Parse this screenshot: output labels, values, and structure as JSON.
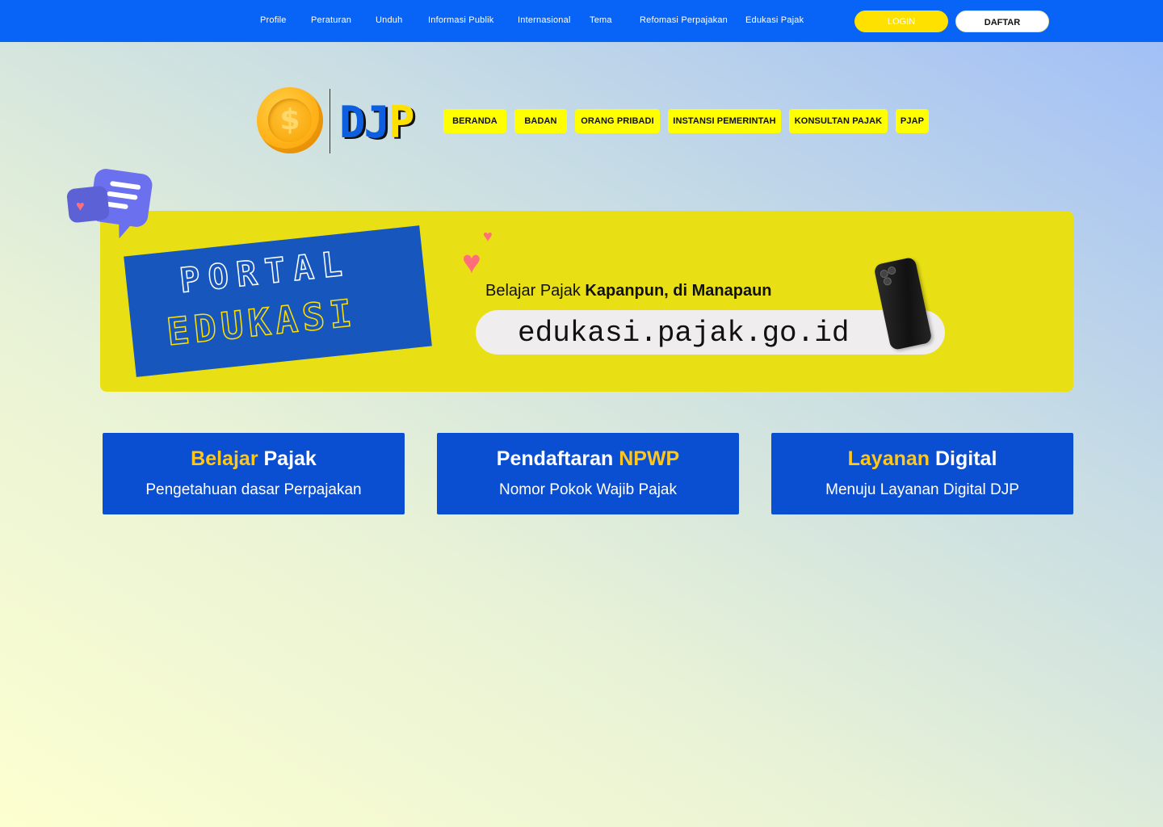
{
  "topnav": {
    "items": [
      "Profile",
      "Peraturan",
      "Unduh",
      "Informasi Publik",
      "Internasional",
      "Tema",
      "Refomasi Perpajakan",
      "Edukasi Pajak"
    ],
    "login_label": "LOGIN",
    "daftar_label": "DAFTAR"
  },
  "logo": {
    "text_dj": "DJ",
    "text_p": "P",
    "coin_symbol": "$"
  },
  "subnav": {
    "items": [
      "BERANDA",
      "BADAN",
      "ORANG PRIBADI",
      "INSTANSI PEMERINTAH",
      "KONSULTAN PAJAK",
      "PJAP"
    ]
  },
  "banner": {
    "portal_line1": "PORTAL",
    "portal_line2": "EDUKASI",
    "tagline_plain": "Belajar Pajak ",
    "tagline_bold": "Kapanpun, di Manapaun",
    "url": "edukasi.pajak.go.id"
  },
  "cards": [
    {
      "title_yellow": "Belajar",
      "title_white": " Pajak",
      "subtitle": "Pengetahuan dasar Perpajakan"
    },
    {
      "title_white": "Pendaftaran ",
      "title_yellow": "NPWP",
      "subtitle": "Nomor Pokok Wajib Pajak"
    },
    {
      "title_yellow": "Layanan",
      "title_white": " Digital",
      "subtitle": "Menuju Layanan Digital DJP"
    }
  ],
  "colors": {
    "topbar": "#0864f6",
    "accent_yellow": "#ffe100",
    "banner_yellow": "#e8e014",
    "card_blue": "#0a4fd2"
  },
  "icons": {
    "chat_bubble": "chat-bubble-icon",
    "heart": "heart-icon",
    "phone": "phone-illustration",
    "coin": "coin-icon"
  }
}
